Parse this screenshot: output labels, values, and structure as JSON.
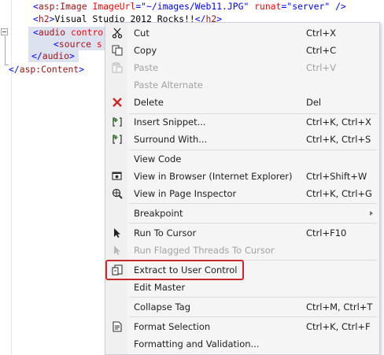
{
  "editor": {
    "lines": [
      {
        "parts": [
          {
            "t": "<",
            "c": "val"
          },
          {
            "t": "asp:Image",
            "c": "tag"
          },
          {
            "t": " ",
            "c": "txt"
          },
          {
            "t": "ImageUrl",
            "c": "attr"
          },
          {
            "t": "=\"~/images/Web11.JPG\"",
            "c": "val"
          },
          {
            "t": " ",
            "c": "txt"
          },
          {
            "t": "runat",
            "c": "attr"
          },
          {
            "t": "=\"server\" />",
            "c": "val"
          }
        ]
      },
      {
        "parts": [
          {
            "t": "<",
            "c": "val"
          },
          {
            "t": "h2",
            "c": "tag"
          },
          {
            "t": ">",
            "c": "val"
          },
          {
            "t": "Visual Studio 2012 Rocks!!",
            "c": "txt"
          },
          {
            "t": "</",
            "c": "val"
          },
          {
            "t": "h2",
            "c": "tag"
          },
          {
            "t": ">",
            "c": "val"
          }
        ]
      },
      {
        "parts": [
          {
            "t": "<",
            "c": "val"
          },
          {
            "t": "audio",
            "c": "tag"
          },
          {
            "t": " ",
            "c": "txt"
          },
          {
            "t": "contro",
            "c": "attr"
          }
        ]
      },
      {
        "parts": [
          {
            "t": "<",
            "c": "val"
          },
          {
            "t": "source",
            "c": "tag"
          },
          {
            "t": " ",
            "c": "txt"
          },
          {
            "t": "s",
            "c": "attr"
          }
        ]
      },
      {
        "parts": [
          {
            "t": "</",
            "c": "val"
          },
          {
            "t": "audio",
            "c": "tag"
          },
          {
            "t": ">",
            "c": "val"
          }
        ]
      },
      {
        "parts": [
          {
            "t": "</",
            "c": "val"
          },
          {
            "t": "asp:Content",
            "c": "tag"
          },
          {
            "t": ">",
            "c": "val"
          }
        ]
      }
    ]
  },
  "context_menu": {
    "highlighted_item": "Extract to User Control",
    "highlight_color": "#c8282b",
    "items": [
      {
        "label": "Cut",
        "shortcut": "Ctrl+X",
        "icon": "scissors-icon",
        "enabled": true
      },
      {
        "label": "Copy",
        "shortcut": "Ctrl+C",
        "icon": "copy-icon",
        "enabled": true
      },
      {
        "label": "Paste",
        "shortcut": "Ctrl+V",
        "icon": "paste-icon",
        "enabled": false
      },
      {
        "label": "Paste Alternate",
        "shortcut": "",
        "icon": "",
        "enabled": false
      },
      {
        "label": "Delete",
        "shortcut": "Del",
        "icon": "delete-icon",
        "enabled": true
      },
      {
        "label": "Insert Snippet...",
        "shortcut": "Ctrl+K, Ctrl+X",
        "icon": "insert-snippet-icon",
        "enabled": true
      },
      {
        "label": "Surround With...",
        "shortcut": "Ctrl+K, Ctrl+S",
        "icon": "surround-with-icon",
        "enabled": true
      },
      {
        "label": "View Code",
        "shortcut": "",
        "icon": "",
        "enabled": true
      },
      {
        "label": "View in Browser (Internet Explorer)",
        "shortcut": "Ctrl+Shift+W",
        "icon": "view-in-browser-icon",
        "enabled": true
      },
      {
        "label": "View in Page Inspector",
        "shortcut": "Ctrl+K, Ctrl+G",
        "icon": "page-inspector-icon",
        "enabled": true
      },
      {
        "label": "Breakpoint",
        "shortcut": "",
        "icon": "",
        "enabled": true,
        "submenu": true
      },
      {
        "label": "Run To Cursor",
        "shortcut": "Ctrl+F10",
        "icon": "run-to-cursor-icon",
        "enabled": true
      },
      {
        "label": "Run Flagged Threads To Cursor",
        "shortcut": "",
        "icon": "run-flagged-threads-icon",
        "enabled": false
      },
      {
        "label": "Extract to User Control",
        "shortcut": "",
        "icon": "extract-user-control-icon",
        "enabled": true
      },
      {
        "label": "Edit Master",
        "shortcut": "",
        "icon": "",
        "enabled": true
      },
      {
        "label": "Collapse Tag",
        "shortcut": "Ctrl+M, Ctrl+T",
        "icon": "",
        "enabled": true
      },
      {
        "label": "Format Selection",
        "shortcut": "Ctrl+K, Ctrl+F",
        "icon": "format-selection-icon",
        "enabled": true
      },
      {
        "label": "Formatting and Validation...",
        "shortcut": "",
        "icon": "",
        "enabled": true
      }
    ]
  }
}
